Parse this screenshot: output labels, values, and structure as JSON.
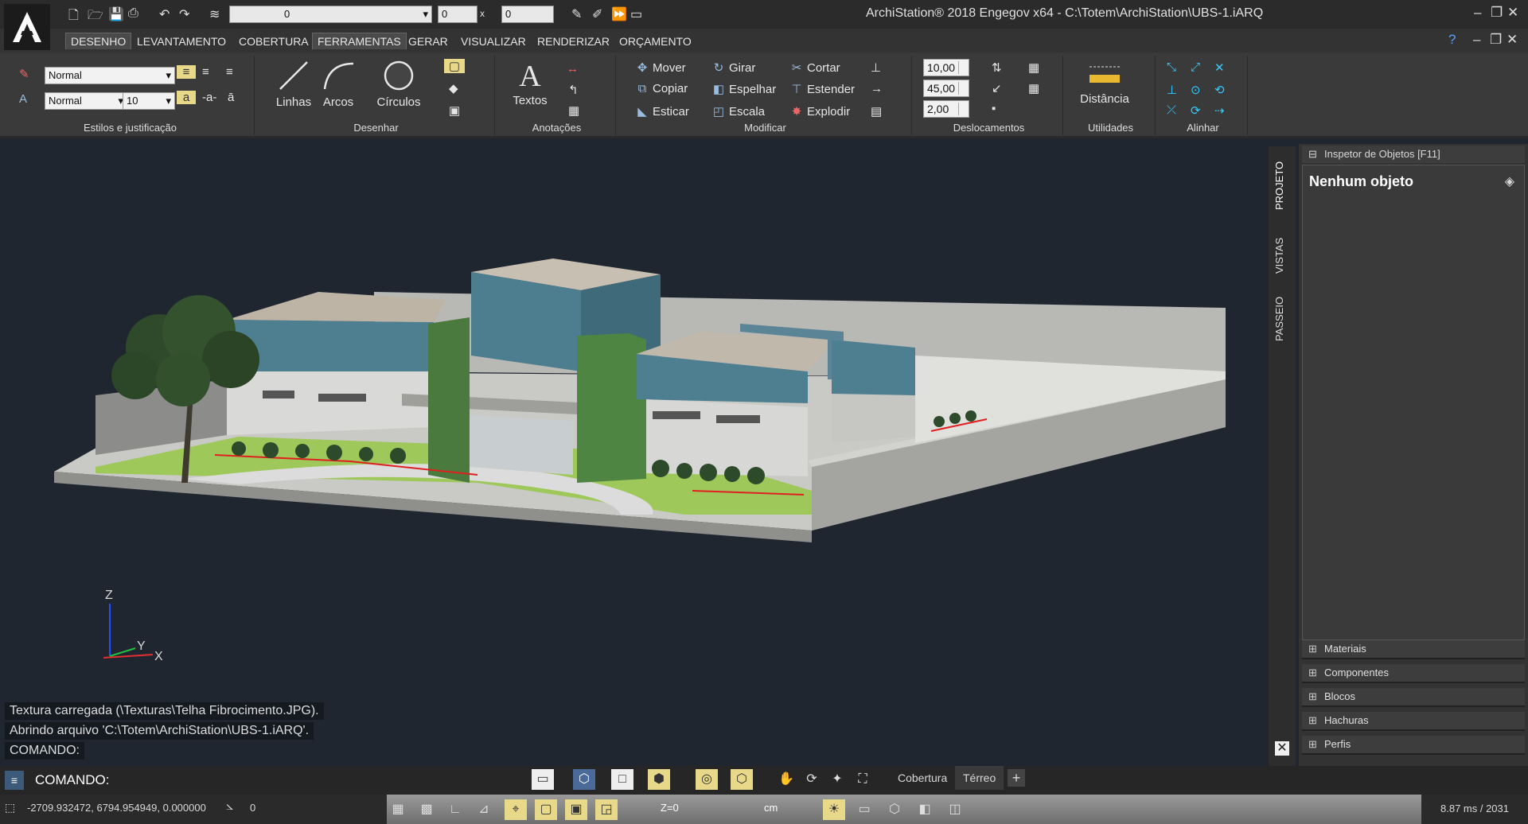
{
  "title_bar": {
    "app_title": "ArchiStation® 2018 Engegov x64   - C:\\Totem\\ArchiStation\\UBS-1.iARQ",
    "layer_value": "0",
    "field_a": "0",
    "field_b": "0"
  },
  "tabs": [
    "DESENHO",
    "LEVANTAMENTO",
    "COBERTURA",
    "FERRAMENTAS",
    "GERAR",
    "VISUALIZAR",
    "RENDERIZAR",
    "ORÇAMENTO"
  ],
  "ribbon": {
    "estilos": {
      "label": "Estilos e justificação",
      "style1": "Normal",
      "style2": "Normal",
      "size": "10"
    },
    "desenhar": {
      "label": "Desenhar",
      "linhas": "Linhas",
      "arcos": "Arcos",
      "circulos": "Círculos"
    },
    "anotacoes": {
      "label": "Anotações",
      "textos": "Textos"
    },
    "modificar": {
      "label": "Modificar",
      "mover": "Mover",
      "copiar": "Copiar",
      "esticar": "Esticar",
      "girar": "Girar",
      "espelhar": "Espelhar",
      "escala": "Escala",
      "cortar": "Cortar",
      "estender": "Estender",
      "explodir": "Explodir"
    },
    "deslocamentos": {
      "label": "Deslocamentos",
      "v1": "10,00",
      "v2": "45,00",
      "v3": "2,00"
    },
    "utilidades": {
      "label": "Utilidades",
      "distancia": "Distância"
    },
    "alinhar": {
      "label": "Alinhar"
    }
  },
  "side_tabs": [
    "PROJETO",
    "VISTAS",
    "PASSEIO"
  ],
  "inspector": {
    "header": "Inspetor de Objetos [F11]",
    "title": "Nenhum objeto",
    "sections": [
      "Materiais",
      "Componentes",
      "Blocos",
      "Hachuras",
      "Perfis"
    ]
  },
  "axes": {
    "z": "Z",
    "y": "Y",
    "x": "X"
  },
  "log": [
    "Textura carregada (\\Texturas\\Telha Fibrocimento.JPG).",
    "Abrindo arquivo 'C:\\Totem\\ArchiStation\\UBS-1.iARQ'.",
    "COMANDO:"
  ],
  "command": {
    "prompt": "COMANDO:",
    "tab1": "Cobertura",
    "tab2": "Térreo"
  },
  "status": {
    "coords": "-2709.932472, 6794.954949, 0.000000",
    "angle": "0",
    "z": "Z=0",
    "units": "cm",
    "perf": "8.87 ms / 2031"
  }
}
